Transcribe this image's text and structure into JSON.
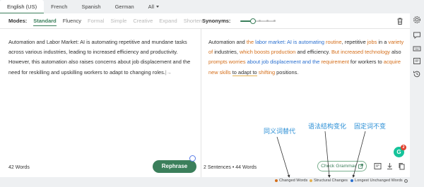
{
  "languages": {
    "tabs": [
      "English (US)",
      "French",
      "Spanish",
      "German"
    ],
    "all_label": "All"
  },
  "toolbar": {
    "modes_label": "Modes:",
    "modes": [
      {
        "label": "Standard",
        "state": "active"
      },
      {
        "label": "Fluency",
        "state": "enabled"
      },
      {
        "label": "Formal",
        "state": "disabled"
      },
      {
        "label": "Simple",
        "state": "disabled"
      },
      {
        "label": "Creative",
        "state": "disabled"
      },
      {
        "label": "Expand",
        "state": "disabled"
      },
      {
        "label": "Shorten",
        "state": "disabled"
      }
    ],
    "synonyms_label": "Synonyms:",
    "synonyms_level": 0.35,
    "trash_icon": "trash-icon"
  },
  "input": {
    "text": "Automation and Labor Market: AI is automating repetitive and mundane tasks across various industries, leading to increased efficiency and productivity. However, this automation also raises concerns about job displacement and the need for reskilling and upskilling workers to adapt to changing roles.",
    "word_count": "42 Words"
  },
  "output": {
    "segments": [
      {
        "t": "Automation and ",
        "k": "plain"
      },
      {
        "t": "the",
        "k": "changed"
      },
      {
        "t": " ",
        "k": "plain"
      },
      {
        "t": "labor market: AI is automating",
        "k": "longest"
      },
      {
        "t": " ",
        "k": "plain"
      },
      {
        "t": "routine",
        "k": "changed"
      },
      {
        "t": ", repetitive ",
        "k": "plain"
      },
      {
        "t": "jobs",
        "k": "changed"
      },
      {
        "t": " in a ",
        "k": "plain"
      },
      {
        "t": "variety of",
        "k": "changed"
      },
      {
        "t": " industries, ",
        "k": "plain"
      },
      {
        "t": "which boosts production",
        "k": "changed"
      },
      {
        "t": " and efficiency. ",
        "k": "plain"
      },
      {
        "t": "But increased technology",
        "k": "changed"
      },
      {
        "t": " also ",
        "k": "plain"
      },
      {
        "t": "prompts worries",
        "k": "changed"
      },
      {
        "t": " ",
        "k": "plain"
      },
      {
        "t": "about job displacement and the",
        "k": "longest"
      },
      {
        "t": " ",
        "k": "plain"
      },
      {
        "t": "requirement",
        "k": "changed"
      },
      {
        "t": " for workers to ",
        "k": "plain"
      },
      {
        "t": "acquire new skills",
        "k": "changed"
      },
      {
        "t": " ",
        "k": "plain"
      },
      {
        "t": "to adapt to",
        "k": "structural"
      },
      {
        "t": " ",
        "k": "plain"
      },
      {
        "t": "shifting",
        "k": "changed"
      },
      {
        "t": " positions.",
        "k": "plain"
      }
    ],
    "stats": "2 Sentences • 44 Words",
    "check_grammar_label": "Check Grammar",
    "grammarly_badge": "G",
    "grammarly_count": "2"
  },
  "rephrase_label": "Rephrase",
  "annotations": {
    "synonym_replace": "同义词替代",
    "structure_change": "语法结构变化",
    "fixed_unchanged": "固定词不变"
  },
  "legend": {
    "changed": "Changed Words",
    "structural": "Structural Changes",
    "longest": "Longest Unchanged Words"
  },
  "colors": {
    "accent": "#3b7f5b",
    "changed": "#d46e1a",
    "structural": "#e4b04e",
    "longest": "#2a6fcf",
    "annotation": "#2b8fd6"
  },
  "rail_icons": [
    "gear-icon",
    "comment-icon",
    "keyboard-icon",
    "tips-icon",
    "history-icon"
  ]
}
